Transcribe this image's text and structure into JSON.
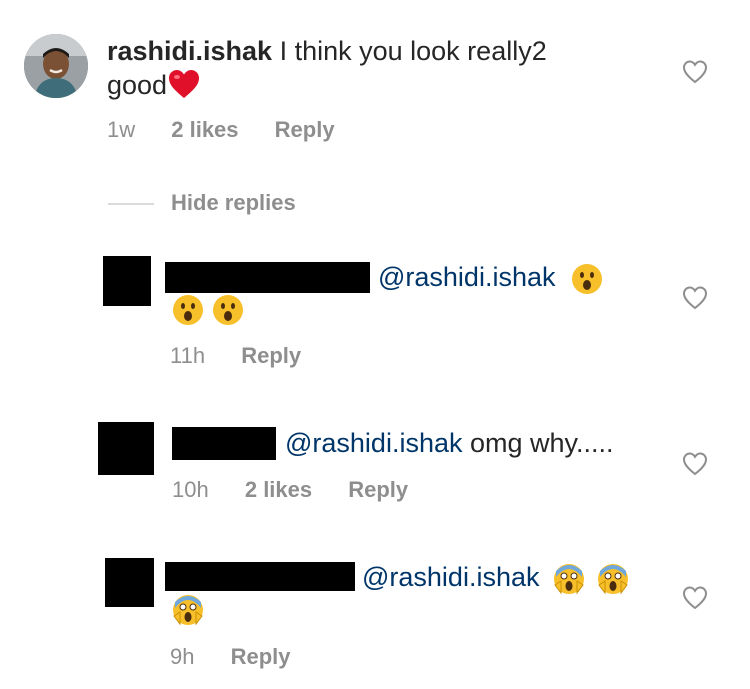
{
  "comment": {
    "username": "rashidi.ishak",
    "text_line1": " I think you look really2",
    "text_line2": "good",
    "time": "1w",
    "likes": "2 likes",
    "reply": "Reply"
  },
  "hide_replies": "Hide replies",
  "replies": [
    {
      "mention": "@rashidi.ishak",
      "time": "11h",
      "reply": "Reply"
    },
    {
      "mention": "@rashidi.ishak",
      "text": " omg why.....",
      "time": "10h",
      "likes": "2 likes",
      "reply": "Reply"
    },
    {
      "mention": "@rashidi.ishak",
      "time": "9h",
      "reply": "Reply"
    }
  ],
  "colors": {
    "mention": "#003569",
    "meta": "#8e8e8e",
    "heart_emoji": "#e0102a"
  }
}
